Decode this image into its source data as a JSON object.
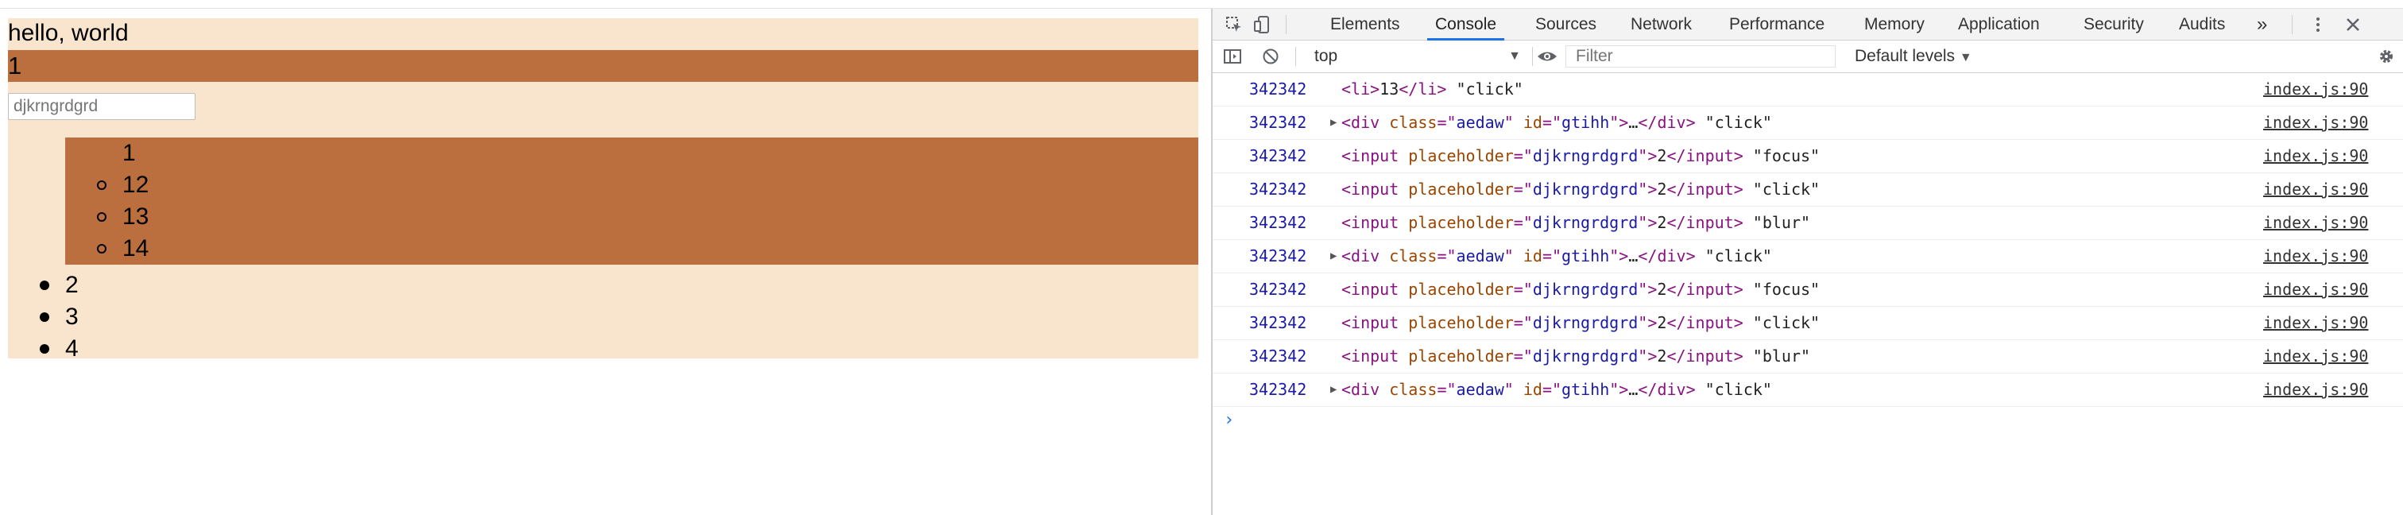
{
  "page": {
    "hello": "hello, world",
    "bar_text": "1",
    "input_placeholder": "djkrngrdgrd",
    "nested_items": [
      "1",
      "12",
      "13",
      "14"
    ],
    "outer_items": [
      "2",
      "3",
      "4"
    ]
  },
  "devtools": {
    "tabs": [
      "Elements",
      "Console",
      "Sources",
      "Network",
      "Performance",
      "Memory",
      "Application",
      "Security",
      "Audits"
    ],
    "active_tab": "Console",
    "more_tabs": "»",
    "context": "top",
    "filter_placeholder": "Filter",
    "levels": "Default levels",
    "logs": [
      {
        "num": "342342",
        "expand": false,
        "parts": [
          [
            "tag",
            "<li>"
          ],
          [
            "str",
            "13"
          ],
          [
            "tag",
            "</li>"
          ],
          [
            "str",
            " \"click\""
          ]
        ],
        "src": "index.js:90"
      },
      {
        "num": "342342",
        "expand": true,
        "parts": [
          [
            "tag",
            "<div "
          ],
          [
            "attr",
            "class"
          ],
          [
            "tag",
            "=\""
          ],
          [
            "aval",
            "aedaw"
          ],
          [
            "tag",
            "\" "
          ],
          [
            "attr",
            "id"
          ],
          [
            "tag",
            "=\""
          ],
          [
            "aval",
            "gtihh"
          ],
          [
            "tag",
            "\">"
          ],
          [
            "str",
            "…"
          ],
          [
            "tag",
            "</div>"
          ],
          [
            "str",
            " \"click\""
          ]
        ],
        "src": "index.js:90"
      },
      {
        "num": "342342",
        "expand": false,
        "parts": [
          [
            "tag",
            "<input "
          ],
          [
            "attr",
            "placeholder"
          ],
          [
            "tag",
            "=\""
          ],
          [
            "aval",
            "djkrngrdgrd"
          ],
          [
            "tag",
            "\">"
          ],
          [
            "str",
            "2"
          ],
          [
            "tag",
            "</input>"
          ],
          [
            "str",
            " \"focus\""
          ]
        ],
        "src": "index.js:90"
      },
      {
        "num": "342342",
        "expand": false,
        "parts": [
          [
            "tag",
            "<input "
          ],
          [
            "attr",
            "placeholder"
          ],
          [
            "tag",
            "=\""
          ],
          [
            "aval",
            "djkrngrdgrd"
          ],
          [
            "tag",
            "\">"
          ],
          [
            "str",
            "2"
          ],
          [
            "tag",
            "</input>"
          ],
          [
            "str",
            " \"click\""
          ]
        ],
        "src": "index.js:90"
      },
      {
        "num": "342342",
        "expand": false,
        "parts": [
          [
            "tag",
            "<input "
          ],
          [
            "attr",
            "placeholder"
          ],
          [
            "tag",
            "=\""
          ],
          [
            "aval",
            "djkrngrdgrd"
          ],
          [
            "tag",
            "\">"
          ],
          [
            "str",
            "2"
          ],
          [
            "tag",
            "</input>"
          ],
          [
            "str",
            " \"blur\""
          ]
        ],
        "src": "index.js:90"
      },
      {
        "num": "342342",
        "expand": true,
        "parts": [
          [
            "tag",
            "<div "
          ],
          [
            "attr",
            "class"
          ],
          [
            "tag",
            "=\""
          ],
          [
            "aval",
            "aedaw"
          ],
          [
            "tag",
            "\" "
          ],
          [
            "attr",
            "id"
          ],
          [
            "tag",
            "=\""
          ],
          [
            "aval",
            "gtihh"
          ],
          [
            "tag",
            "\">"
          ],
          [
            "str",
            "…"
          ],
          [
            "tag",
            "</div>"
          ],
          [
            "str",
            " \"click\""
          ]
        ],
        "src": "index.js:90"
      },
      {
        "num": "342342",
        "expand": false,
        "parts": [
          [
            "tag",
            "<input "
          ],
          [
            "attr",
            "placeholder"
          ],
          [
            "tag",
            "=\""
          ],
          [
            "aval",
            "djkrngrdgrd"
          ],
          [
            "tag",
            "\">"
          ],
          [
            "str",
            "2"
          ],
          [
            "tag",
            "</input>"
          ],
          [
            "str",
            " \"focus\""
          ]
        ],
        "src": "index.js:90"
      },
      {
        "num": "342342",
        "expand": false,
        "parts": [
          [
            "tag",
            "<input "
          ],
          [
            "attr",
            "placeholder"
          ],
          [
            "tag",
            "=\""
          ],
          [
            "aval",
            "djkrngrdgrd"
          ],
          [
            "tag",
            "\">"
          ],
          [
            "str",
            "2"
          ],
          [
            "tag",
            "</input>"
          ],
          [
            "str",
            " \"click\""
          ]
        ],
        "src": "index.js:90"
      },
      {
        "num": "342342",
        "expand": false,
        "parts": [
          [
            "tag",
            "<input "
          ],
          [
            "attr",
            "placeholder"
          ],
          [
            "tag",
            "=\""
          ],
          [
            "aval",
            "djkrngrdgrd"
          ],
          [
            "tag",
            "\">"
          ],
          [
            "str",
            "2"
          ],
          [
            "tag",
            "</input>"
          ],
          [
            "str",
            " \"blur\""
          ]
        ],
        "src": "index.js:90"
      },
      {
        "num": "342342",
        "expand": true,
        "parts": [
          [
            "tag",
            "<div "
          ],
          [
            "attr",
            "class"
          ],
          [
            "tag",
            "=\""
          ],
          [
            "aval",
            "aedaw"
          ],
          [
            "tag",
            "\" "
          ],
          [
            "attr",
            "id"
          ],
          [
            "tag",
            "=\""
          ],
          [
            "aval",
            "gtihh"
          ],
          [
            "tag",
            "\">"
          ],
          [
            "str",
            "…"
          ],
          [
            "tag",
            "</div>"
          ],
          [
            "str",
            " \"click\""
          ]
        ],
        "src": "index.js:90"
      }
    ],
    "prompt_symbol": "›",
    "icons": {
      "inspect": "inspect-icon",
      "device": "device-toggle-icon",
      "kebab": "kebab-menu-icon",
      "close": "close-icon",
      "sidebar": "sidebar-toggle-icon",
      "clear": "clear-console-icon",
      "eye": "live-expression-icon",
      "settings": "settings-gear-icon"
    },
    "colors": {
      "page_bg": "#f9e5cd",
      "accent_bar": "#bc6f3e",
      "tab_underline": "#1a73e8",
      "log_number": "#1a1aa6",
      "tag": "#881280",
      "attr": "#994500"
    }
  }
}
